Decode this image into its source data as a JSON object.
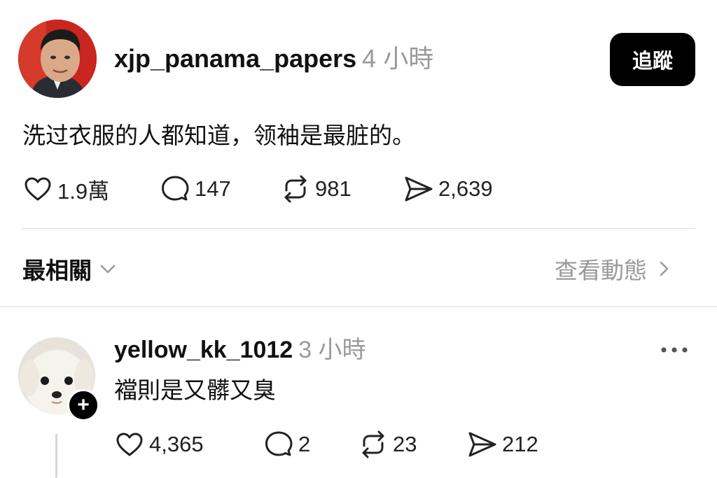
{
  "post": {
    "username": "xjp_panama_papers",
    "time": "4 小時",
    "follow_label": "追蹤",
    "text": "洗过衣服的人都知道，领袖是最脏的。",
    "stats": {
      "likes": "1.9萬",
      "comments": "147",
      "reposts": "981",
      "shares": "2,639"
    }
  },
  "replies_header": {
    "sort_label": "最相關",
    "view_activity_label": "查看動態"
  },
  "reply": {
    "username": "yellow_kk_1012",
    "time": "3 小時",
    "text": "襠則是又髒又臭",
    "stats": {
      "likes": "4,365",
      "comments": "2",
      "reposts": "23",
      "shares": "212"
    }
  },
  "icons": {
    "like": "heart-icon",
    "comment": "comment-bubble-icon",
    "repost": "repost-icon",
    "share": "send-icon",
    "sort_chevron": "chevron-down-icon",
    "activity_chevron": "chevron-right-icon",
    "more": "more-horizontal-icon",
    "follow_badge": "plus-icon"
  },
  "colors": {
    "primary_text": "#111111",
    "secondary_text": "#9a9a9a",
    "follow_button_bg": "#000000",
    "divider": "#dedede"
  }
}
